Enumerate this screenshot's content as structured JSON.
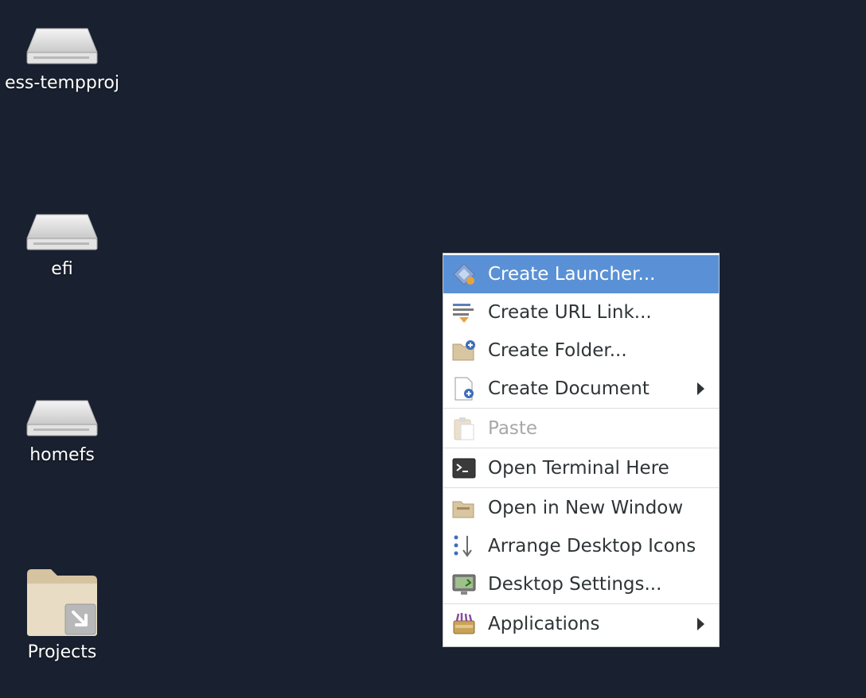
{
  "desktop": {
    "icons": [
      {
        "label": "ess-tempproj",
        "icon": "drive-harddisk-icon"
      },
      {
        "label": "efi",
        "icon": "drive-harddisk-icon"
      },
      {
        "label": "homefs",
        "icon": "drive-harddisk-icon"
      },
      {
        "label": "Projects",
        "icon": "folder-link-icon"
      }
    ]
  },
  "context_menu": {
    "items": [
      {
        "label": "Create Launcher...",
        "icon": "launcher-icon",
        "highlighted": true
      },
      {
        "label": "Create URL Link...",
        "icon": "url-link-icon"
      },
      {
        "label": "Create Folder...",
        "icon": "folder-new-icon"
      },
      {
        "label": "Create Document",
        "icon": "document-new-icon",
        "submenu": true
      },
      {
        "label": "Paste",
        "icon": "paste-icon",
        "disabled": true
      },
      {
        "label": "Open Terminal Here",
        "icon": "terminal-icon"
      },
      {
        "label": "Open in New Window",
        "icon": "folder-open-icon"
      },
      {
        "label": "Arrange Desktop Icons",
        "icon": "arrange-icons-icon"
      },
      {
        "label": "Desktop Settings...",
        "icon": "desktop-settings-icon"
      },
      {
        "label": "Applications",
        "icon": "applications-icon",
        "submenu": true
      }
    ]
  },
  "colors": {
    "desktop_background": "#19202f",
    "menu_highlight": "#5a91d6",
    "menu_background": "#ffffff"
  }
}
